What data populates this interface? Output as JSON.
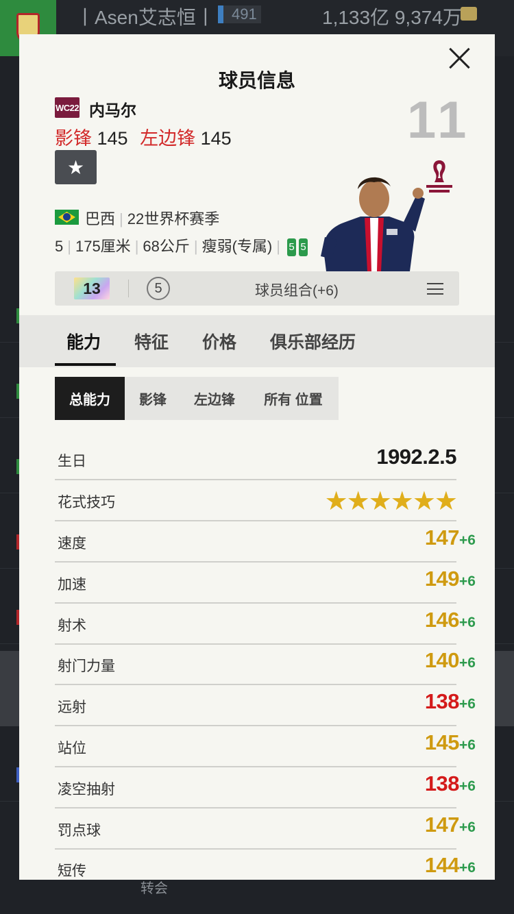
{
  "background": {
    "username": "丨Asen艾志恒丨",
    "level": "491",
    "money": "1,133亿 9,374万",
    "bottom_tab": "转会"
  },
  "modal": {
    "title": "球员信息",
    "close_icon": "close-icon"
  },
  "player": {
    "card_season_badge": "WC22",
    "name": "内马尔",
    "positions": [
      {
        "name": "影锋",
        "ovr": "145"
      },
      {
        "name": "左边锋",
        "ovr": "145"
      }
    ],
    "favorite_icon": "star-icon",
    "jersey_number": "11",
    "nation": "巴西",
    "season": "22世界杯赛季",
    "weak_foot": "5",
    "height": "175厘米",
    "weight": "68公斤",
    "body_type": "瘦弱(专属)",
    "skill_chips": [
      "5",
      "5"
    ]
  },
  "combo_bar": {
    "upgrade_level": "13",
    "grade": "5",
    "label": "球员组合(+6)",
    "menu_icon": "menu-icon"
  },
  "tabs": {
    "main": [
      "能力",
      "特征",
      "价格",
      "俱乐部经历"
    ],
    "sub": [
      "总能力",
      "影锋",
      "左边锋",
      "所有 位置"
    ]
  },
  "info": {
    "birthday_label": "生日",
    "birthday_value": "1992.2.5",
    "skill_moves_label": "花式技巧",
    "skill_moves_stars": "★★★★★★"
  },
  "stats": [
    {
      "label": "速度",
      "value": "147",
      "bonus": "+6",
      "color": "#cf9a10"
    },
    {
      "label": "加速",
      "value": "149",
      "bonus": "+6",
      "color": "#cf9a10"
    },
    {
      "label": "射术",
      "value": "146",
      "bonus": "+6",
      "color": "#cf9a10"
    },
    {
      "label": "射门力量",
      "value": "140",
      "bonus": "+6",
      "color": "#cf9a10"
    },
    {
      "label": "远射",
      "value": "138",
      "bonus": "+6",
      "color": "#d41a1a"
    },
    {
      "label": "站位",
      "value": "145",
      "bonus": "+6",
      "color": "#cf9a10"
    },
    {
      "label": "凌空抽射",
      "value": "138",
      "bonus": "+6",
      "color": "#d41a1a"
    },
    {
      "label": "罚点球",
      "value": "147",
      "bonus": "+6",
      "color": "#cf9a10"
    },
    {
      "label": "短传",
      "value": "144",
      "bonus": "+6",
      "color": "#cf9a10"
    }
  ]
}
